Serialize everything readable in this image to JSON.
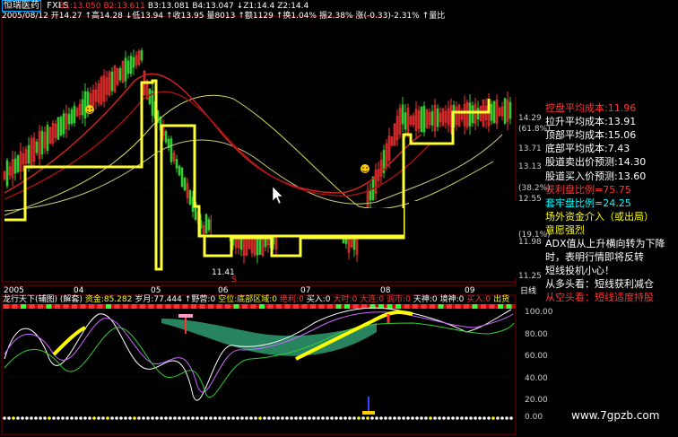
{
  "stock": {
    "name": "恒瑞医药",
    "code": "FXLS"
  },
  "header": {
    "top_row": [
      {
        "t": "B1:13.050",
        "c": "#ff3333"
      },
      {
        "t": "B2:13.611",
        "c": "#ff3333"
      },
      {
        "t": "B3:13.081",
        "c": "#ffffff"
      },
      {
        "t": "B4:13.047",
        "c": "#ffffff"
      },
      {
        "t": "↓Z1:14.4",
        "c": "#ffffff"
      },
      {
        "t": "Z2:14.4",
        "c": "#ffffff"
      }
    ],
    "quote_row": {
      "date": "2005/08/12",
      "items": [
        "开14.27",
        "↑高14.28",
        "↓低13.94",
        "↑收13.95",
        "量8013",
        "↑额1129",
        "↑换1.04%",
        "振2.38%",
        "涨(-0.33)-2.31%",
        "↑量比"
      ]
    }
  },
  "price_axis": [
    "14.29",
    "(61.8%)",
    "13.71",
    "13.13",
    "(38.2%)",
    "12.55",
    "(19.1%)",
    "11.98",
    "11.25"
  ],
  "chart_labels": {
    "low_marker": "11.41",
    "signal": "S"
  },
  "time_axis": [
    "2005",
    "04",
    "05",
    "06",
    "07",
    "08",
    "09"
  ],
  "sub_panel": {
    "title": "龙行天下(辅图)",
    "mode": "(解套)",
    "indicators": [
      {
        "t": "资金:85.282",
        "c": "#ffff00"
      },
      {
        "t": "岁月:77.444",
        "c": "#ffffff"
      },
      {
        "t": "↑野营:0",
        "c": "#ffffff"
      },
      {
        "t": "空位:底部区域:0",
        "c": "#ffff00"
      },
      {
        "t": "绝利:0",
        "c": "#ff3333"
      },
      {
        "t": "买入:0",
        "c": "#ffffff"
      },
      {
        "t": "大吋:0",
        "c": "#ff3333"
      },
      {
        "t": "大连:0",
        "c": "#ff3333"
      },
      {
        "t": "调市:0",
        "c": "#ff3333"
      },
      {
        "t": "天神:0",
        "c": "#ffffff"
      },
      {
        "t": "境神:0",
        "c": "#ffffff"
      },
      {
        "t": "买入:0",
        "c": "#ff3333"
      },
      {
        "t": "出货",
        "c": "#ffff00"
      }
    ],
    "axis": [
      "100.00",
      "80.00",
      "60.00",
      "40.00",
      "20.00",
      "0.00"
    ],
    "right_tab": "日线"
  },
  "right_panel": [
    {
      "t": "控盘平均成本:11.96",
      "c": "#ff3333"
    },
    {
      "t": "拉升平均成本:13.91",
      "c": "#ffffff"
    },
    {
      "t": "顶部平均成本:15.06",
      "c": "#ffffff"
    },
    {
      "t": "底部平均成本:7.43",
      "c": "#ffffff"
    },
    {
      "t": "股道卖出价预测:14.30",
      "c": "#ffffff"
    },
    {
      "t": "股道买入价预测:13.60",
      "c": "#ffffff"
    },
    {
      "t": "获利盘比例=75.75",
      "c": "#ff3333"
    },
    {
      "t": "套牢盘比例=24.25",
      "c": "#00ffff"
    },
    {
      "t": "场外资金介入（或出局）",
      "c": "#ffff00"
    },
    {
      "t": "意愿强烈",
      "c": "#ffff00"
    },
    {
      "t": "ADX值从上升横向转为下降",
      "c": "#ffffff"
    },
    {
      "t": "时，表明行情即将反转",
      "c": "#ffffff"
    },
    {
      "t": "短线投机小心！",
      "c": "#ffffff"
    },
    {
      "t": "从多头看：短线获利减仓",
      "c": "#ffffff"
    },
    {
      "t": "从空头看：短线适度持股",
      "c": "#ff3333"
    }
  ],
  "watermark": "www.7gpzb.com"
}
